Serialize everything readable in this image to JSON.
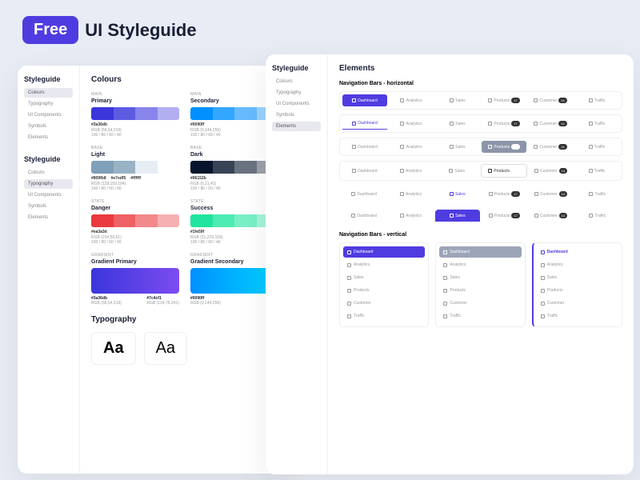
{
  "header": {
    "badge": "Free",
    "title": "UI Styleguide"
  },
  "sidebar": {
    "title": "Styleguide",
    "items": [
      "Colours",
      "Typography",
      "UI Components",
      "Symbols",
      "Elements"
    ]
  },
  "colours": {
    "title": "Colours",
    "items": [
      {
        "label": "MAIN",
        "name": "Primary",
        "hex": "#3a36db",
        "rgb": "RGB (58,54,219)",
        "opacity": "100 / 80 / 60 / 40",
        "shades": [
          "#3a36db",
          "#5e5be3",
          "#8784eb",
          "#b1aef2"
        ]
      },
      {
        "label": "MAIN",
        "name": "Secondary",
        "hex": "#0090ff",
        "rgb": "RGB (0,144,255)",
        "opacity": "100 / 80 / 60 / 40",
        "shades": [
          "#0090ff",
          "#33a6ff",
          "#66bcff",
          "#99d3ff"
        ]
      },
      {
        "label": "BASE",
        "name": "Light",
        "hex": "#809fb8",
        "rgb": "RGB (128,159,184)",
        "opacity": "100 / 80 / 60 / 40",
        "shades": [
          "#809fb8",
          "#99b2c6",
          "#e7edf5",
          "#ffffff"
        ],
        "extras": [
          "#e7edf5",
          "#ffffff"
        ]
      },
      {
        "label": "BASE",
        "name": "Dark",
        "hex": "#06152b",
        "rgb": "RGB (6,21,43)",
        "opacity": "100 / 80 / 60 / 40",
        "shades": [
          "#06152b",
          "#384455",
          "#6a7380",
          "#9ba1aa"
        ]
      },
      {
        "label": "STATE",
        "name": "Danger",
        "hex": "#ea3a3d",
        "rgb": "RGB (234,58,61)",
        "opacity": "100 / 80 / 60 / 40",
        "shades": [
          "#ea3a3d",
          "#ee6164",
          "#f2898b",
          "#f7b0b1"
        ]
      },
      {
        "label": "STATE",
        "name": "Success",
        "hex": "#1fe59f",
        "rgb": "RGB (31,229,159)",
        "opacity": "100 / 80 / 60 / 40",
        "shades": [
          "#1fe59f",
          "#4cebb2",
          "#79f0c5",
          "#a5f5d9"
        ]
      }
    ],
    "gradients": [
      {
        "label": "GRADIENT",
        "name": "Gradient Primary",
        "from": "#3a36db",
        "to": "#7c4cf1",
        "fromHex": "#3a36db",
        "fromRgb": "RGB (58,54,219)",
        "toHex": "#7c4cf1",
        "toRgb": "RGB (124,76,241)"
      },
      {
        "label": "GRADIENT",
        "name": "Gradient Secondary",
        "from": "#0090ff",
        "to": "#00d4ff",
        "fromHex": "#0090ff",
        "fromRgb": "RGB (0,144,255)",
        "toHex": "",
        "toRgb": "RGB"
      }
    ]
  },
  "typography": {
    "title": "Typography",
    "sample": "Aa"
  },
  "elements": {
    "title": "Elements",
    "horizontal": "Navigation Bars - horizontal",
    "vertical": "Navigation Bars - vertical",
    "nav": [
      {
        "icon": "grid",
        "label": "Dashboard",
        "badge": ""
      },
      {
        "icon": "clock",
        "label": "Analytics",
        "badge": ""
      },
      {
        "icon": "chart",
        "label": "Sales",
        "badge": ""
      },
      {
        "icon": "bag",
        "label": "Products",
        "badge": "17"
      },
      {
        "icon": "user",
        "label": "Customer",
        "badge": "14"
      },
      {
        "icon": "traffic",
        "label": "Traffic",
        "badge": ""
      }
    ]
  }
}
